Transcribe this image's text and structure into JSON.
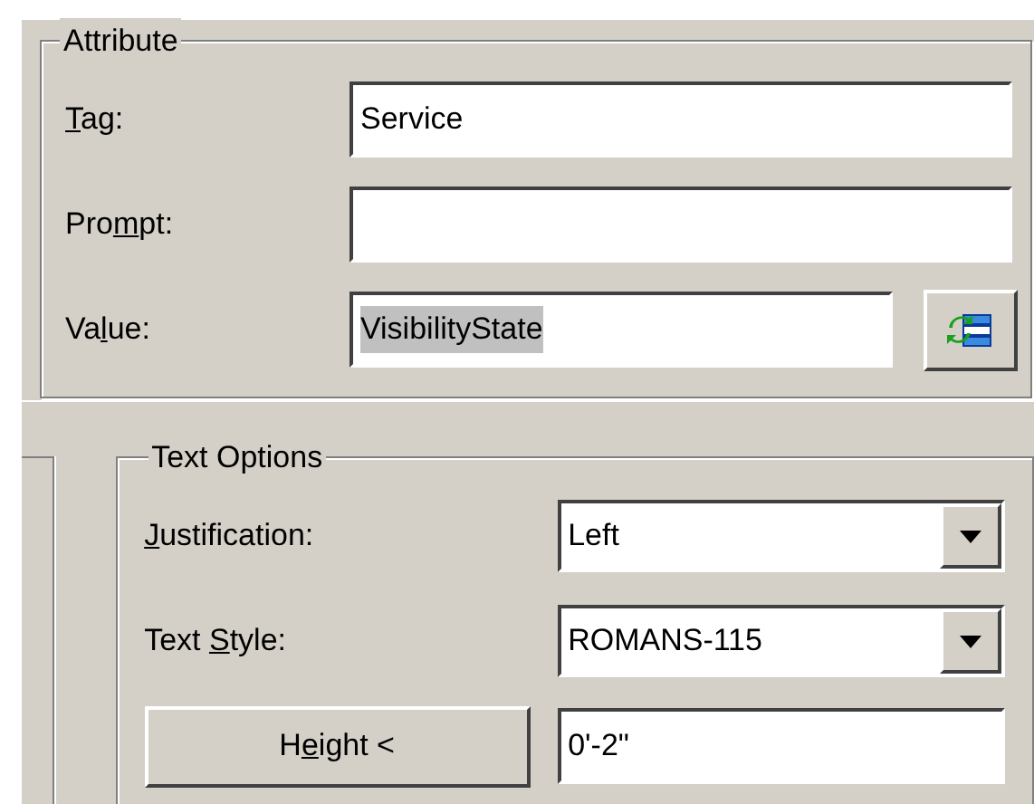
{
  "attribute_group": {
    "title": "Attribute",
    "fields": [
      {
        "label": {
          "key": "T",
          "post": "ag:"
        },
        "value": "Service",
        "kind": "text",
        "highlighted": false
      },
      {
        "label": {
          "pre": "Pro",
          "key": "m",
          "post": "pt:"
        },
        "kind": "text",
        "highlighted": false
      },
      {
        "label": {
          "pre": "Va",
          "key": "l",
          "post": "ue:"
        },
        "value": "VisibilityState",
        "kind": "field-button",
        "highlighted": true
      }
    ]
  },
  "text_options_group": {
    "title": "Text Options",
    "rows": [
      {
        "kind": "combo",
        "label": {
          "key": "J",
          "post": "ustification:"
        },
        "value": "Left"
      },
      {
        "kind": "combo",
        "label": {
          "pre": "Text ",
          "key": "S",
          "post": "tyle:"
        },
        "value": "ROMANS-115"
      },
      {
        "kind": "button",
        "label": {
          "pre": "H",
          "key": "e",
          "post": "ight <"
        },
        "value": "0'-2\""
      }
    ]
  }
}
